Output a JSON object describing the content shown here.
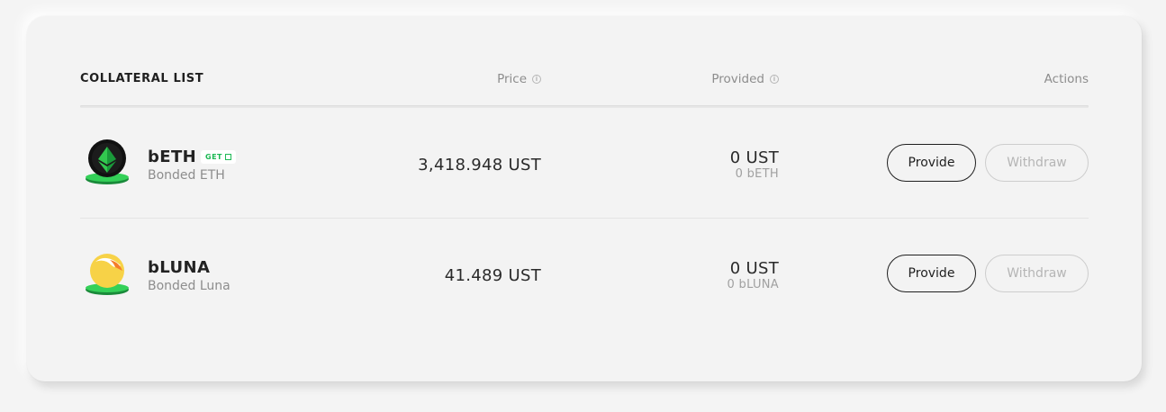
{
  "header": {
    "title": "COLLATERAL LIST",
    "price_label": "Price",
    "provided_label": "Provided",
    "actions_label": "Actions"
  },
  "rows": [
    {
      "symbol": "bETH",
      "badge": "GET",
      "name": "Bonded ETH",
      "price": "3,418.948 UST",
      "provided": "0 UST",
      "provided_sub": "0 bETH",
      "provide_label": "Provide",
      "withdraw_label": "Withdraw",
      "icon": "beth-token-icon"
    },
    {
      "symbol": "bLUNA",
      "name": "Bonded Luna",
      "price": "41.489 UST",
      "provided": "0 UST",
      "provided_sub": "0 bLUNA",
      "provide_label": "Provide",
      "withdraw_label": "Withdraw",
      "icon": "bluna-token-icon"
    }
  ],
  "colors": {
    "accent_green": "#1db954",
    "text_dark": "#1f1f1f",
    "text_muted": "#8d8d8d",
    "disabled": "#b5b5b5"
  }
}
